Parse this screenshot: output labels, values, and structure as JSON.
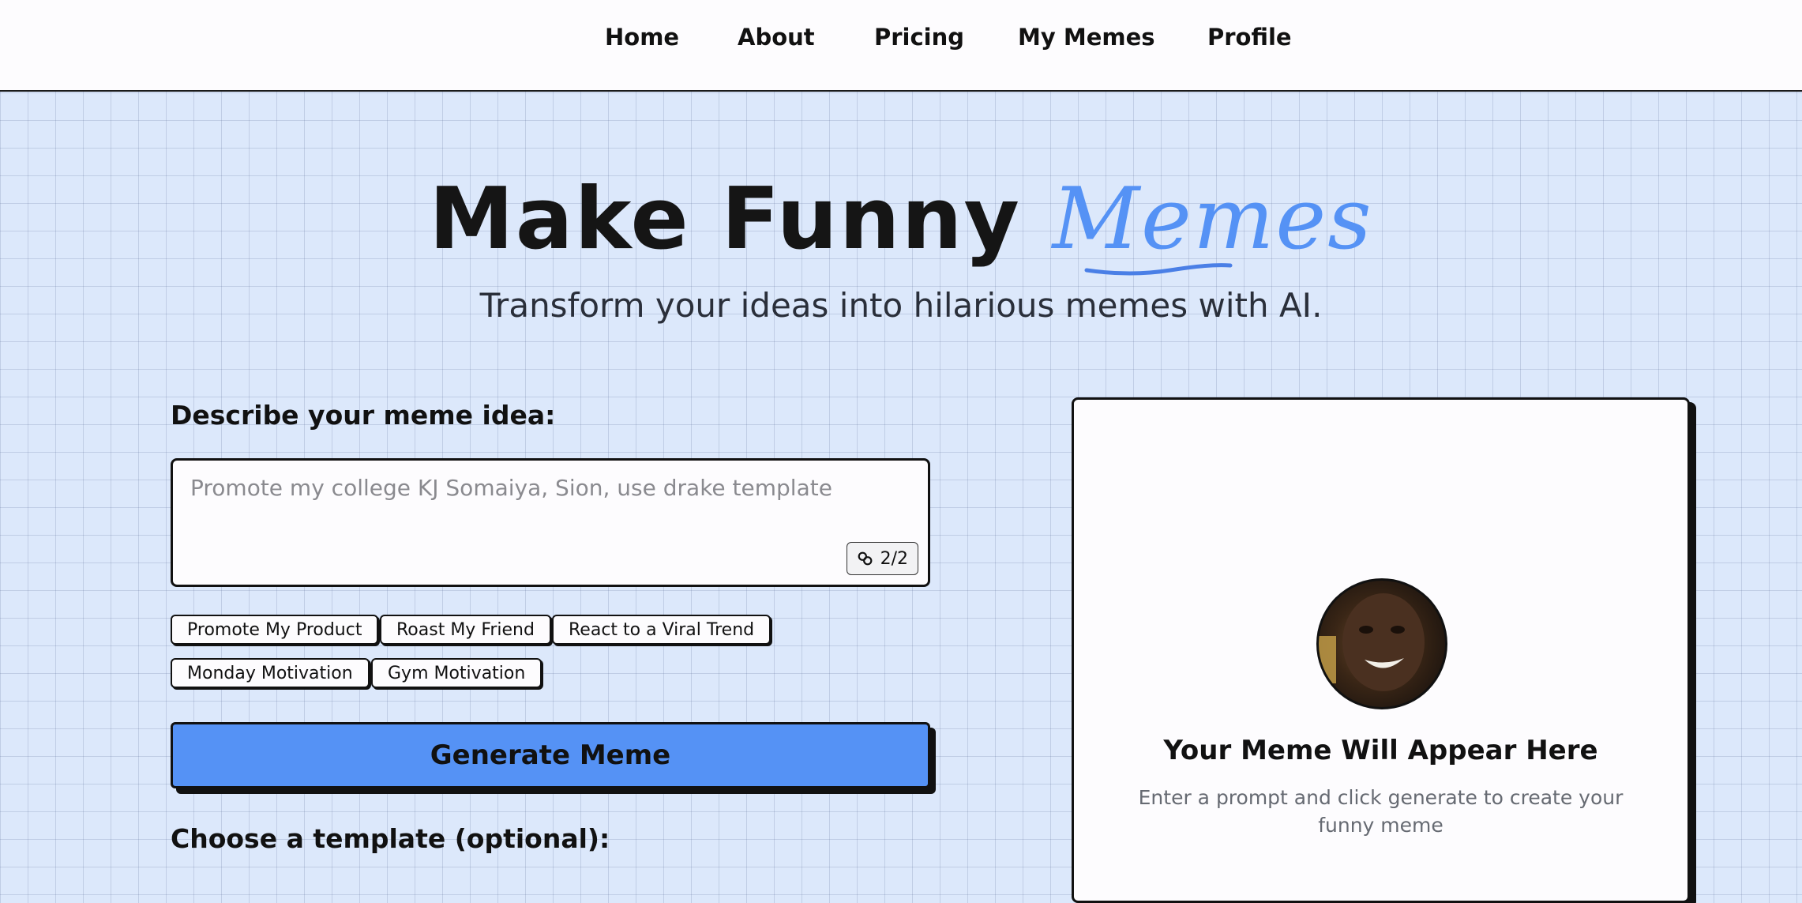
{
  "nav": {
    "items": [
      {
        "label": "Home"
      },
      {
        "label": "About"
      },
      {
        "label": "Pricing"
      },
      {
        "label": "My Memes"
      },
      {
        "label": "Profile"
      }
    ]
  },
  "hero": {
    "title_main": "Make Funny ",
    "title_highlight": "Memes",
    "subtitle": "Transform your ideas into hilarious memes with AI."
  },
  "form": {
    "prompt_label": "Describe your meme idea:",
    "prompt_placeholder": "Promote my college KJ Somaiya, Sion, use drake template",
    "prompt_value": "",
    "counter": "2/2",
    "chips": [
      {
        "label": "Promote My Product"
      },
      {
        "label": "Roast My Friend"
      },
      {
        "label": "React to a Viral Trend"
      },
      {
        "label": "Monday Motivation"
      },
      {
        "label": "Gym Motivation"
      }
    ],
    "generate_label": "Generate Meme",
    "template_label": "Choose a template (optional):"
  },
  "preview": {
    "title": "Your Meme Will Appear Here",
    "subtitle": "Enter a prompt and click generate to create your funny meme"
  },
  "colors": {
    "accent": "#5592f5",
    "background": "#dce8fb",
    "border": "#111111"
  },
  "icons": {
    "counter": "link-icon",
    "avatar": "meme-face-avatar"
  }
}
